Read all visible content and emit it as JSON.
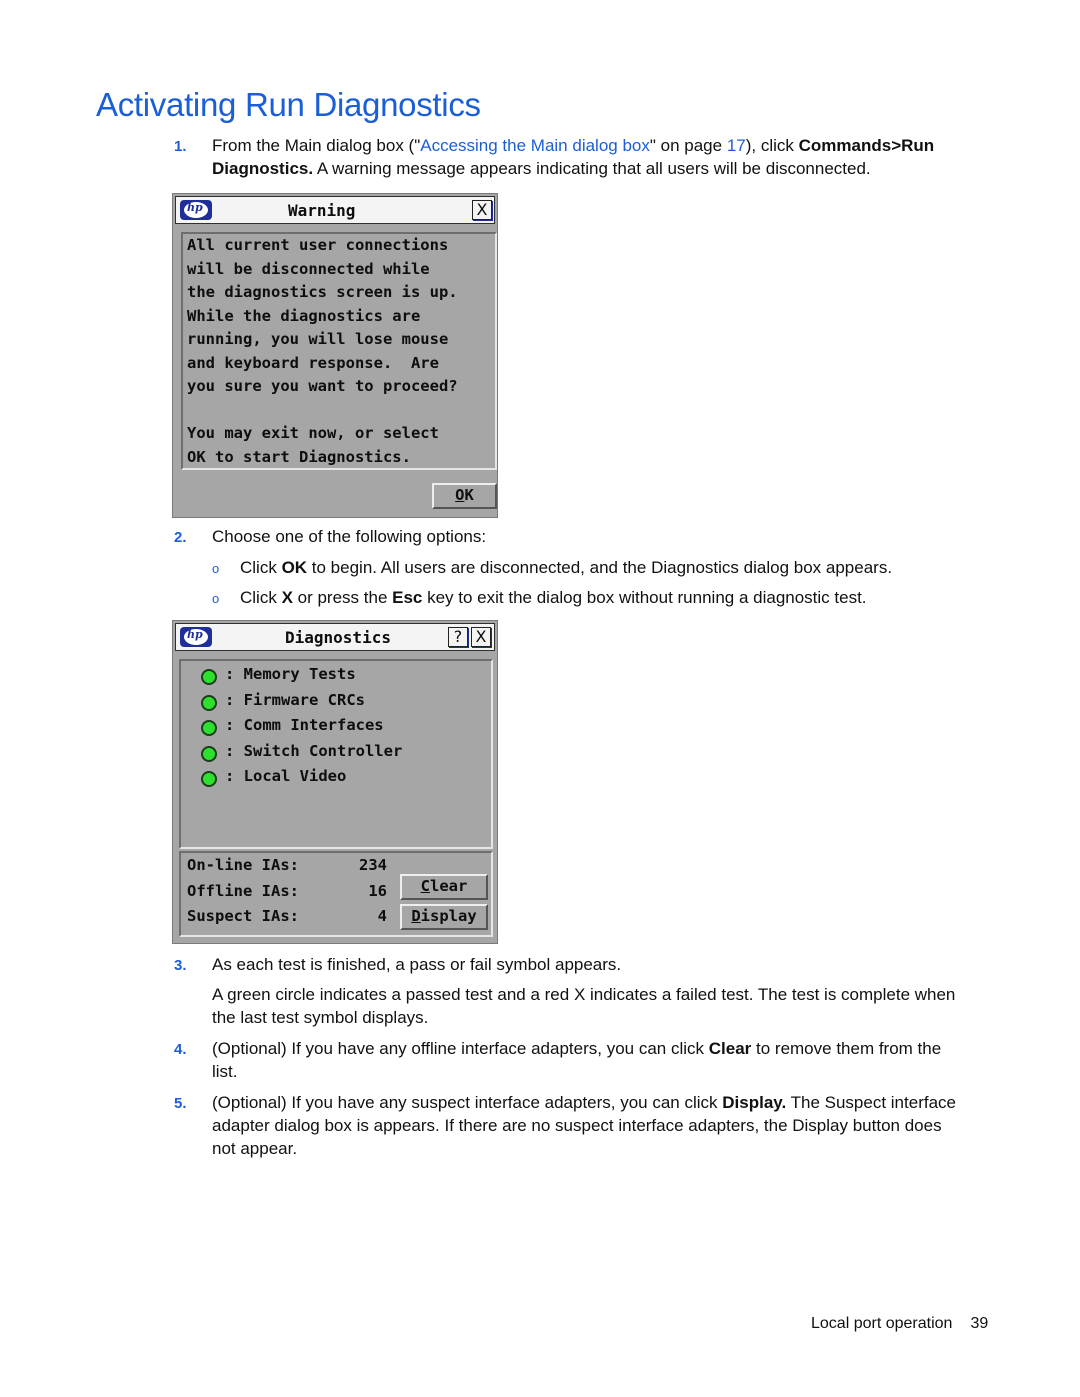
{
  "page": {
    "title": "Activating Run Diagnostics",
    "footer": {
      "section": "Local port operation",
      "page_number": "39"
    }
  },
  "steps": [
    {
      "number": "1.",
      "text_before_link": "From the Main dialog box (\"",
      "link_text": "Accessing the Main dialog box",
      "text_mid": "\" on page ",
      "page_ref": "17",
      "text_after_ref": "), click ",
      "bold_1": "Commands>Run",
      "bold_2": "Diagnostics.",
      "text_end": " A warning message appears indicating that all users will be disconnected."
    },
    {
      "number": "2.",
      "text": "Choose one of the following options:",
      "options": [
        {
          "bullet": "o",
          "pre": "Click ",
          "bold": "OK",
          "post": " to begin. All users are disconnected, and the Diagnostics dialog box appears."
        },
        {
          "bullet": "o",
          "pre": "Click ",
          "bold": "X",
          "mid": " or press the ",
          "bold2": "Esc",
          "post": " key to exit the dialog box without running a diagnostic test."
        }
      ]
    },
    {
      "number": "3.",
      "text": "As each test is finished, a pass or fail symbol appears.",
      "detail_line1": "A green circle indicates a passed test and a red X indicates a failed test. The test is complete when",
      "detail_line2": "the last test symbol displays."
    },
    {
      "number": "4.",
      "pre": "(Optional) If you have any offline interface adapters, you can click ",
      "bold": "Clear",
      "post": " to remove them from the",
      "line2": "list."
    },
    {
      "number": "5.",
      "pre": "(Optional) If you have any suspect interface adapters, you can click ",
      "bold": "Display.",
      "post": " The Suspect interface",
      "line2": "adapter dialog box is appears. If there are no suspect interface adapters, the Display button does",
      "line3": "not appear."
    }
  ],
  "warning_dialog": {
    "logo": "hp",
    "title": "Warning",
    "close_icon": "X",
    "message_lines": [
      "All current user connections",
      "will be disconnected while",
      "the diagnostics screen is up.",
      "While the diagnostics are",
      "running, you will lose mouse",
      "and keyboard response.  Are",
      "you sure you want to proceed?",
      "",
      "You may exit now, or select",
      "OK to start Diagnostics."
    ],
    "ok_button": {
      "hotkey": "O",
      "rest": "K"
    }
  },
  "diagnostics_dialog": {
    "logo": "hp",
    "title": "Diagnostics",
    "help_icon": "?",
    "close_icon": "X",
    "tests": [
      {
        "label": ": Memory Tests",
        "status": "pass"
      },
      {
        "label": ": Firmware CRCs",
        "status": "pass"
      },
      {
        "label": ": Comm Interfaces",
        "status": "pass"
      },
      {
        "label": ": Switch Controller",
        "status": "pass"
      },
      {
        "label": ": Local Video",
        "status": "pass"
      }
    ],
    "status_colors": {
      "pass": "#2ee02e"
    },
    "counts": [
      {
        "label": "On-line IAs:",
        "value": "234"
      },
      {
        "label": "Offline IAs:",
        "value": "16"
      },
      {
        "label": "Suspect IAs:",
        "value": "4"
      }
    ],
    "clear_button": {
      "hotkey": "C",
      "rest": "lear"
    },
    "display_button": {
      "hotkey": "D",
      "rest": "isplay"
    }
  }
}
